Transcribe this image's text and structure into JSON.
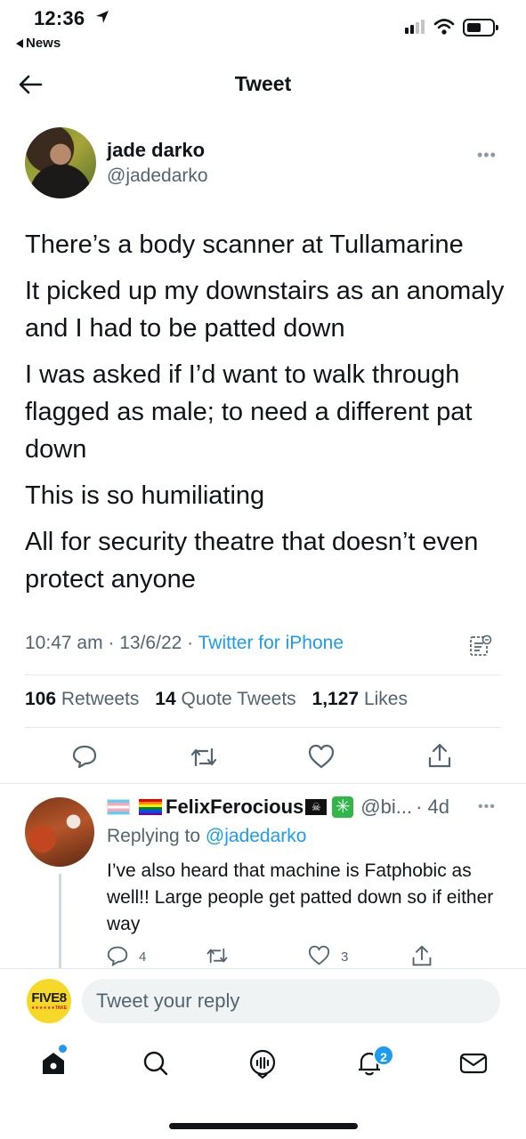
{
  "status_bar": {
    "time": "12:36",
    "back_app": "News",
    "cellular_icon": "cellular-signal-icon",
    "wifi_icon": "wifi-icon",
    "battery_icon": "battery-icon"
  },
  "nav": {
    "title": "Tweet",
    "back_icon": "back-arrow-icon"
  },
  "tweet": {
    "author_name": "jade darko",
    "author_handle": "@jadedarko",
    "paragraphs": [
      "There’s a body scanner at Tullamarine",
      "It picked up my downstairs as an anomaly and I had to be patted down",
      "I was asked if I’d want to walk through flagged as male; to need a different pat down",
      "This is so humiliating",
      "All for security theatre that doesn’t even protect anyone"
    ],
    "time": "10:47 am",
    "date": "13/6/22",
    "source": "Twitter for iPhone",
    "retweets_count": "106",
    "retweets_label": "Retweets",
    "quotes_count": "14",
    "quotes_label": "Quote Tweets",
    "likes_count": "1,127",
    "likes_label": "Likes"
  },
  "reply": {
    "name": "FelixFerocious",
    "handle": "@bi...",
    "age": "· 4d",
    "replying_prefix": "Replying to",
    "replying_to": "@jadedarko",
    "text": "I’ve also heard that machine is Fatphobic as well!! Large people get patted down so if either way",
    "reply_count": "4",
    "like_count": "3"
  },
  "compose": {
    "placeholder": "Tweet your reply",
    "avatar_text": "FIVE8",
    "avatar_subtext": "★★★★★★TAKE"
  },
  "tab_bar": {
    "notifications_badge": "2",
    "icons": [
      "home-icon",
      "search-icon",
      "spaces-icon",
      "notifications-icon",
      "messages-icon"
    ]
  },
  "colors": {
    "accent": "#1d9bf0",
    "secondary_text": "#536471",
    "primary_text": "#0f1419"
  }
}
